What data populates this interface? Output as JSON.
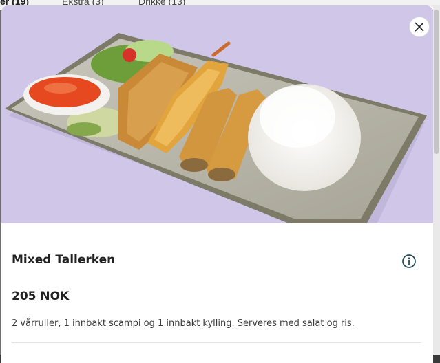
{
  "background_tabs": [
    {
      "label": "er (19)",
      "active": true
    },
    {
      "label": "Ekstra (3)",
      "active": false
    },
    {
      "label": "Drikke (13)",
      "active": false
    }
  ],
  "product": {
    "image_alt": "Mixed Tallerken",
    "name": "Mixed Tallerken",
    "price": "205 NOK",
    "description": "2 vårruller, 1 innbakt scampi og 1 innbakt kylling. Serveres med salat og ris."
  },
  "icons": {
    "close": "close-icon",
    "info": "info-icon"
  },
  "colors": {
    "hero_background": "#cfc6e8",
    "text": "#222222",
    "info_icon": "#1f4e5a"
  }
}
